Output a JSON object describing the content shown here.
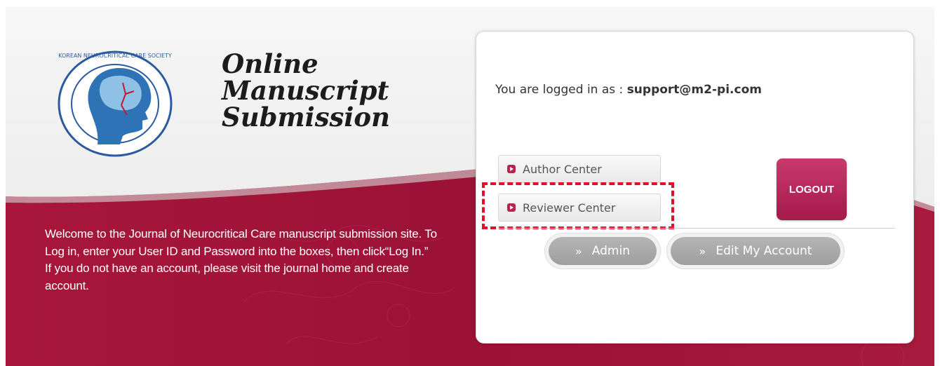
{
  "logo": {
    "ring_text_top": "KOREAN NEUROCRITICAL CARE SOCIETY",
    "ring_text_bottom": "KOREAN NEUROCRITICAL CARE SOCIETY"
  },
  "title": [
    "Online",
    "Manuscript",
    "Submission"
  ],
  "welcome": [
    "Welcome to the Journal of Neurocritical Care manuscript submission site. To Log in, enter your User ID and Password into the boxes, then click“Log In.”",
    "If you do not have an account, please visit the journal home and create account."
  ],
  "session": {
    "prefix": "You are logged in as : ",
    "user": "support@m2-pi.com"
  },
  "nav": {
    "author": "Author Center",
    "reviewer": "Reviewer Center"
  },
  "logout": "LOGOUT",
  "pills": {
    "arrow": "»",
    "admin": "Admin",
    "account": "Edit My Account"
  },
  "colors": {
    "brand": "#a6163f",
    "button_gray": "#a9a9a9",
    "highlight": "#e0102a"
  }
}
